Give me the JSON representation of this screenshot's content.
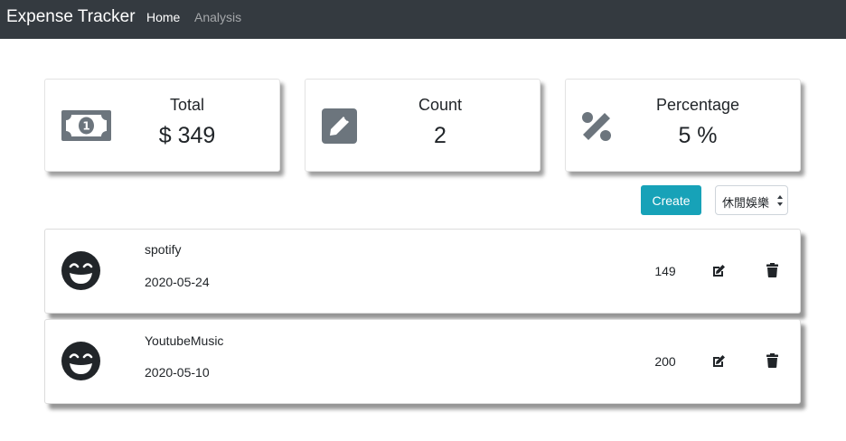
{
  "navbar": {
    "brand": "Expense Tracker",
    "links": [
      {
        "label": "Home",
        "active": true
      },
      {
        "label": "Analysis",
        "active": false
      }
    ]
  },
  "summary_cards": [
    {
      "title": "Total",
      "value": "$ 349",
      "icon": "money-bill-icon"
    },
    {
      "title": "Count",
      "value": "2",
      "icon": "pen-square-icon"
    },
    {
      "title": "Percentage",
      "value": "5 %",
      "icon": "percent-icon"
    }
  ],
  "actions": {
    "create_label": "Create",
    "category_select": "休閒娛樂"
  },
  "records": [
    {
      "name": "spotify",
      "date": "2020-05-24",
      "amount": "149",
      "icon": "grin-icon"
    },
    {
      "name": "YoutubeMusic",
      "date": "2020-05-10",
      "amount": "200",
      "icon": "grin-icon"
    }
  ],
  "colors": {
    "navbar_bg": "#343a40",
    "create_button": "#17a2b8",
    "icon_gray": "#6c757d",
    "icon_dark": "#212529"
  }
}
